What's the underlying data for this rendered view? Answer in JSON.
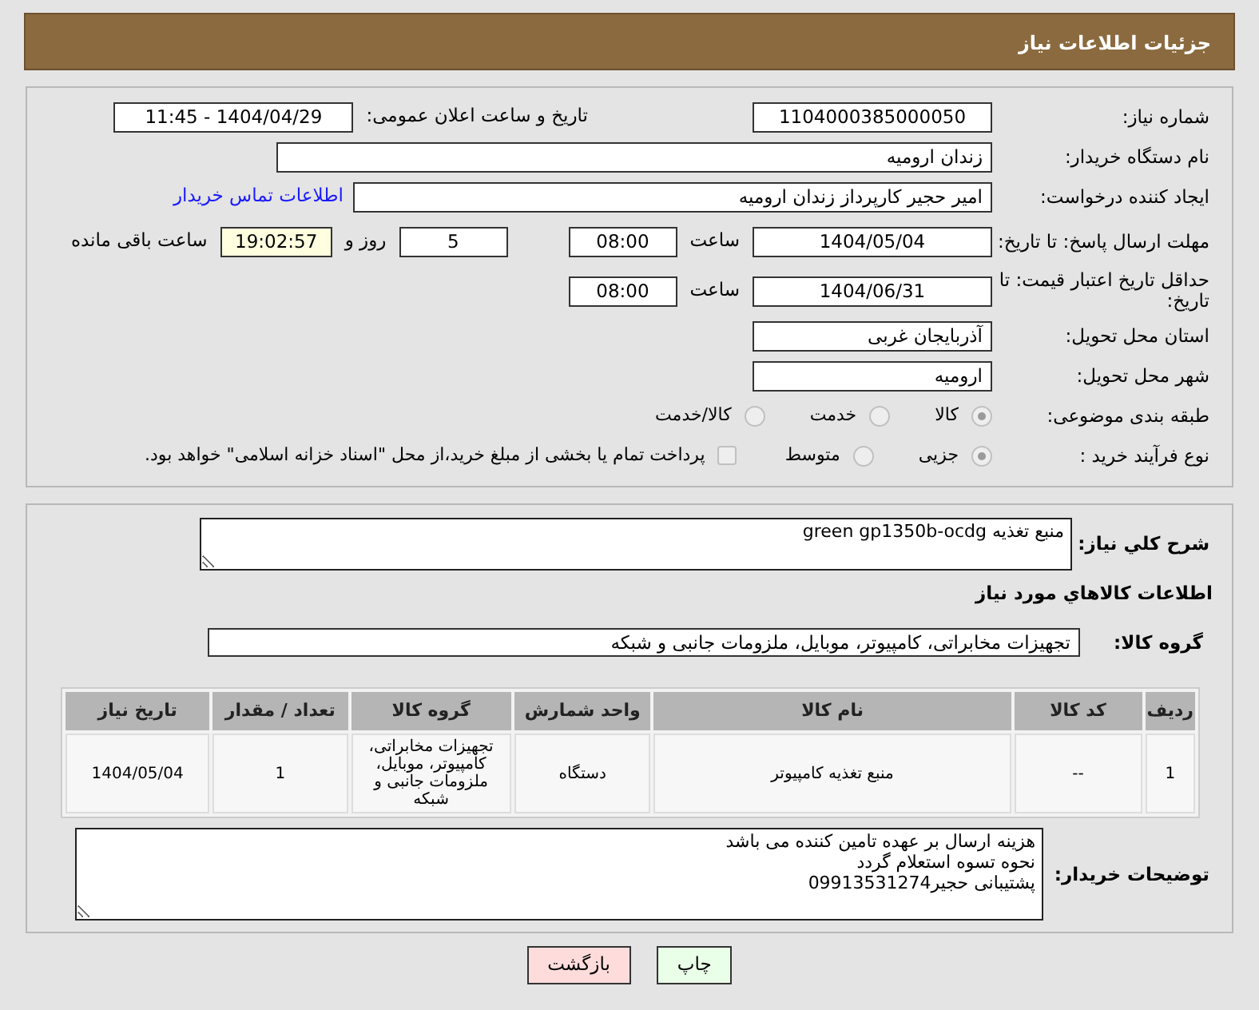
{
  "title": "جزئیات اطلاعات نیاز",
  "need_number": {
    "label": "شماره نیاز:",
    "value": "1104000385000050"
  },
  "announce": {
    "label": "تاریخ و ساعت اعلان عمومی:",
    "value": "1404/04/29 - 11:45"
  },
  "buyer_org": {
    "label": "نام دستگاه خریدار:",
    "value": "زندان ارومیه"
  },
  "requester": {
    "label": "ایجاد کننده درخواست:",
    "value": "امیر حجیر کارپرداز زندان ارومیه",
    "contact_link": "اطلاعات تماس خریدار"
  },
  "reply_deadline": {
    "label": "مهلت ارسال پاسخ: تا تاریخ:",
    "date": "1404/05/04",
    "time_label": "ساعت",
    "time": "08:00",
    "days": "5",
    "days_label": "روز و",
    "remaining": "19:02:57",
    "remaining_label": "ساعت باقی مانده"
  },
  "price_validity": {
    "label": "حداقل تاریخ اعتبار قیمت: تا تاریخ:",
    "date": "1404/06/31",
    "time_label": "ساعت",
    "time": "08:00"
  },
  "province": {
    "label": "استان محل تحویل:",
    "value": "آذربایجان غربی"
  },
  "city": {
    "label": "شهر محل تحویل:",
    "value": "ارومیه"
  },
  "category": {
    "label": "طبقه بندی موضوعی:",
    "options": [
      {
        "label": "کالا",
        "selected": true
      },
      {
        "label": "خدمت",
        "selected": false
      },
      {
        "label": "کالا/خدمت",
        "selected": false
      }
    ]
  },
  "process": {
    "label": "نوع فرآیند خرید :",
    "options": [
      {
        "label": "جزیی",
        "selected": true
      },
      {
        "label": "متوسط",
        "selected": false
      }
    ],
    "payment_note": {
      "text": "پرداخت تمام یا بخشی از مبلغ خرید،از محل \"اسناد خزانه اسلامی\" خواهد بود.",
      "checked": false
    }
  },
  "summary": {
    "label": "شرح کلي نياز:",
    "value": "منبع تغذیه green gp1350b-ocdg"
  },
  "goods_heading": "اطلاعات کالاهاي مورد نياز",
  "goods_group": {
    "label": "گروه کالا:",
    "value": "تجهیزات مخابراتی، کامپیوتر، موبایل، ملزومات جانبی و شبکه"
  },
  "table": {
    "columns": [
      "ردیف",
      "کد کالا",
      "نام کالا",
      "واحد شمارش",
      "گروه کالا",
      "تعداد / مقدار",
      "تاریخ نیاز"
    ],
    "rows": [
      [
        "1",
        "--",
        "منبع تغذیه کامپیوتر",
        "دستگاه",
        "تجهیزات مخابراتی، کامپیوتر، موبایل، ملزومات جانبی و شبکه",
        "1",
        "1404/05/04"
      ]
    ]
  },
  "buyer_notes": {
    "label": "توضیحات خریدار:",
    "value": "هزینه ارسال بر عهده تامین کننده می باشد\nنحوه تسوه استعلام گردد\nپشتیبانی حجیر09913531274"
  },
  "buttons": [
    {
      "label": "چاپ",
      "kind": "print"
    },
    {
      "label": "بازگشت",
      "kind": "back"
    }
  ]
}
